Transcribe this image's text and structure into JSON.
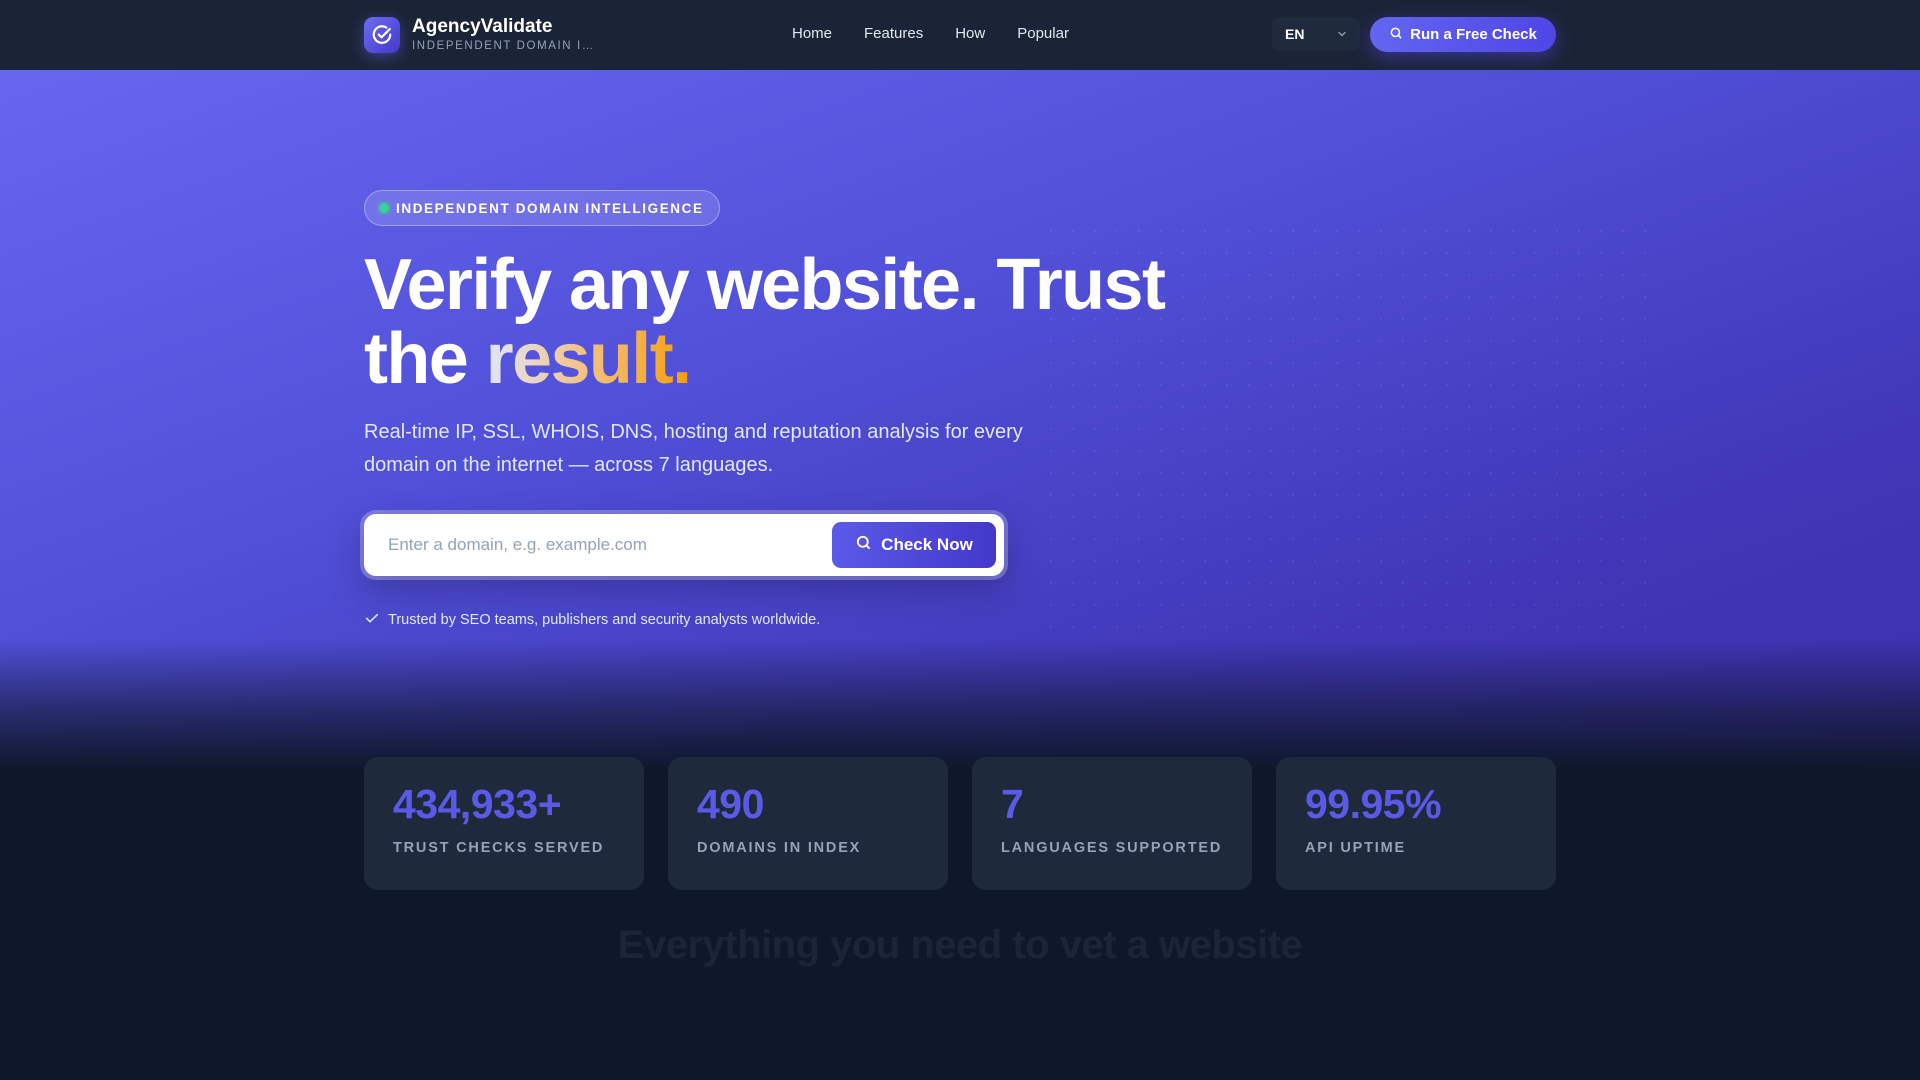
{
  "nav": {
    "brand_name": "AgencyValidate",
    "brand_tagline": "INDEPENDENT DOMAIN I…",
    "links": [
      "Home",
      "Features",
      "How",
      "Popular"
    ],
    "language": "EN",
    "cta_label": "Run a Free Check"
  },
  "hero": {
    "badge": "INDEPENDENT DOMAIN INTELLIGENCE",
    "headline_part1": "Verify any website. Trust the ",
    "headline_accent": "result.",
    "subtitle": "Real-time IP, SSL, WHOIS, DNS, hosting and reputation analysis for every domain on the internet — across 7 languages.",
    "search_placeholder": "Enter a domain, e.g. example.com",
    "search_button": "Check Now",
    "trust_note": "Trusted by SEO teams, publishers and security analysts worldwide."
  },
  "stats": [
    {
      "value": "434,933+",
      "label": "TRUST CHECKS SERVED"
    },
    {
      "value": "490",
      "label": "DOMAINS IN INDEX"
    },
    {
      "value": "7",
      "label": "LANGUAGES SUPPORTED"
    },
    {
      "value": "99.95%",
      "label": "API UPTIME"
    }
  ],
  "features": {
    "title": "Everything you need to vet a website"
  },
  "colors": {
    "accent": "#6366f1",
    "nav_bg": "#1b2436",
    "page_bg": "#0f172a",
    "card_bg": "#1e293b",
    "stat_value": "#5a5ae6",
    "status_dot": "#34d399"
  }
}
